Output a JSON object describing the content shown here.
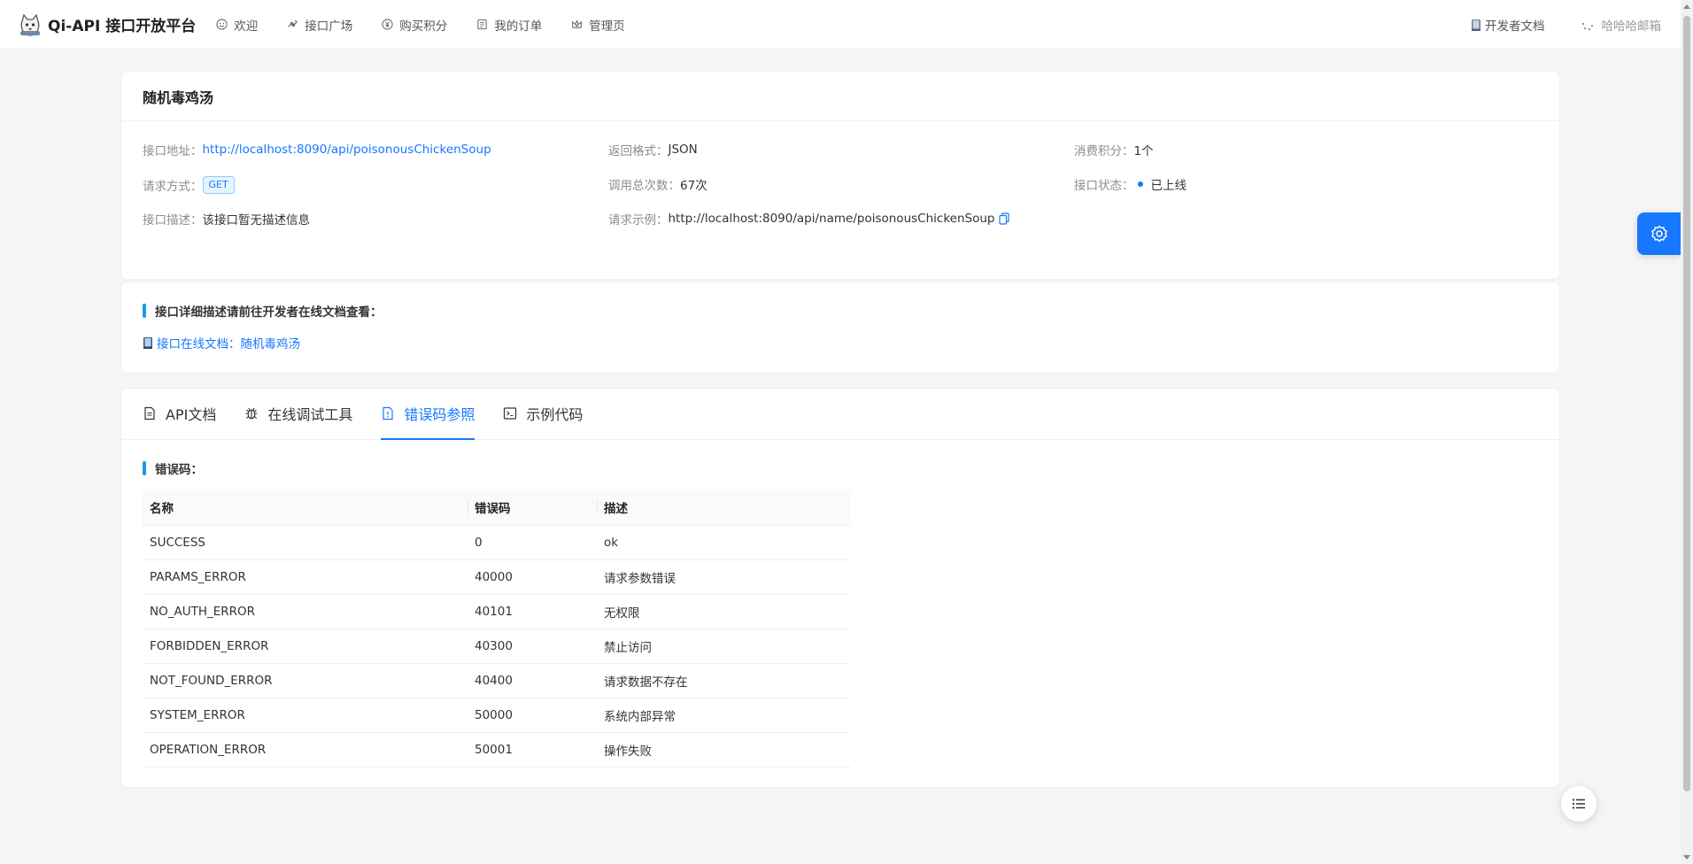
{
  "header": {
    "title": "Qi-API 接口开放平台",
    "nav": [
      {
        "label": "欢迎",
        "icon": "smile-icon"
      },
      {
        "label": "接口广场",
        "icon": "api-icon"
      },
      {
        "label": "购买积分",
        "icon": "pay-circle-icon"
      },
      {
        "label": "我的订单",
        "icon": "order-icon"
      },
      {
        "label": "管理页",
        "icon": "crown-icon"
      }
    ],
    "dev_docs": "开发者文档",
    "username": "哈哈哈邮箱"
  },
  "api_info": {
    "name": "随机毒鸡汤",
    "address_label": "接口地址：",
    "address": "http://localhost:8090/api/poisonousChickenSoup",
    "format_label": "返回格式：",
    "format": "JSON",
    "cost_label": "消费积分：",
    "cost": "1个",
    "method_label": "请求方式：",
    "method": "GET",
    "calls_label": "调用总次数：",
    "calls": "67次",
    "status_label": "接口状态：",
    "status": "已上线",
    "desc_label": "接口描述：",
    "desc": "该接口暂无描述信息",
    "example_label": "请求示例：",
    "example": "http://localhost:8090/api/name/poisonousChickenSoup"
  },
  "docs_section": {
    "title": "接口详细描述请前往开发者在线文档查看：",
    "link": "接口在线文档：随机毒鸡汤"
  },
  "tabs": [
    {
      "label": "API文档",
      "icon": "file-icon"
    },
    {
      "label": "在线调试工具",
      "icon": "bug-icon"
    },
    {
      "label": "错误码参照",
      "icon": "file-exclamation-icon"
    },
    {
      "label": "示例代码",
      "icon": "code-icon"
    }
  ],
  "errors": {
    "title": "错误码：",
    "columns": [
      "名称",
      "错误码",
      "描述"
    ],
    "rows": [
      [
        "SUCCESS",
        "0",
        "ok"
      ],
      [
        "PARAMS_ERROR",
        "40000",
        "请求参数错误"
      ],
      [
        "NO_AUTH_ERROR",
        "40101",
        "无权限"
      ],
      [
        "FORBIDDEN_ERROR",
        "40300",
        "禁止访问"
      ],
      [
        "NOT_FOUND_ERROR",
        "40400",
        "请求数据不存在"
      ],
      [
        "SYSTEM_ERROR",
        "50000",
        "系统内部异常"
      ],
      [
        "OPERATION_ERROR",
        "50001",
        "操作失败"
      ]
    ]
  },
  "colors": {
    "primary": "#1677ff",
    "accent_bar": "#1a9be8"
  }
}
